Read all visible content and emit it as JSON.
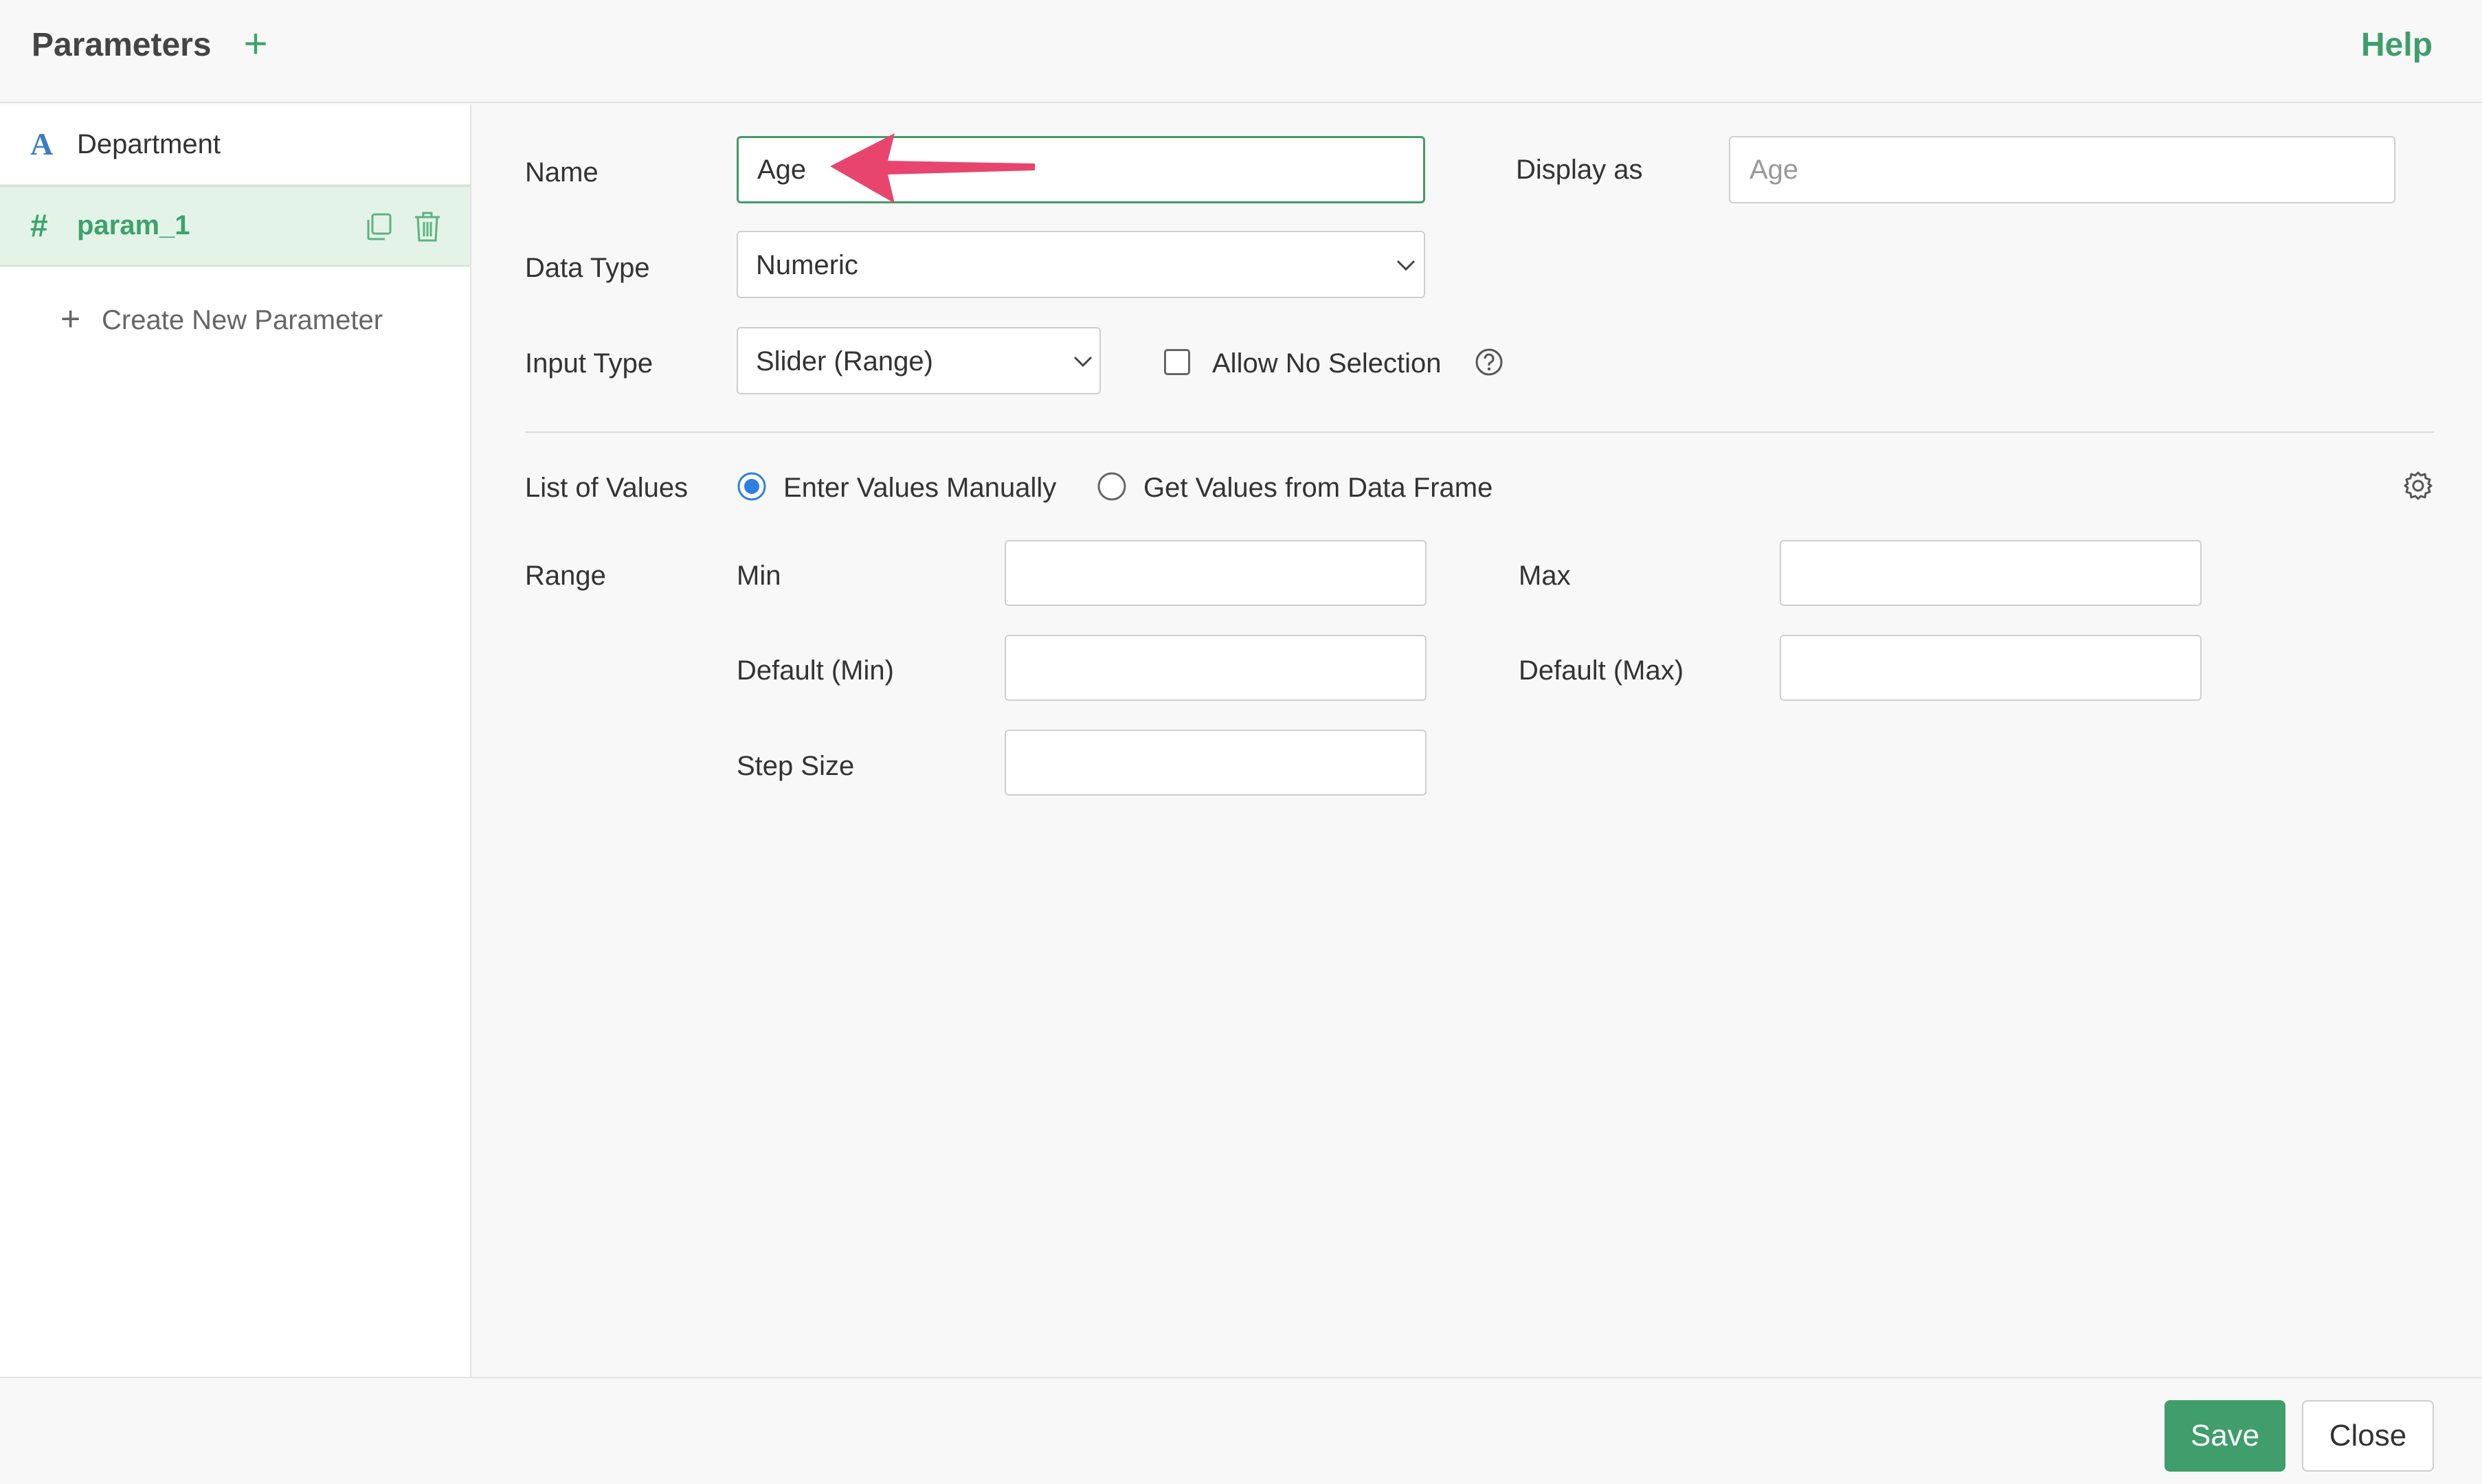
{
  "header": {
    "title": "Parameters",
    "add_icon": "plus-icon",
    "help_label": "Help"
  },
  "sidebar": {
    "items": [
      {
        "type_glyph": "A",
        "label": "Department",
        "selected": false
      },
      {
        "type_glyph": "#",
        "label": "param_1",
        "selected": true
      }
    ],
    "create_new_label": "Create New Parameter"
  },
  "form": {
    "name_label": "Name",
    "name_value": "Age",
    "display_as_label": "Display as",
    "display_as_placeholder": "Age",
    "data_type_label": "Data Type",
    "data_type_value": "Numeric",
    "input_type_label": "Input Type",
    "input_type_value": "Slider (Range)",
    "allow_no_selection_label": "Allow No Selection",
    "allow_no_selection_checked": false,
    "list_of_values_label": "List of Values",
    "radio_manual_label": "Enter Values Manually",
    "radio_manual_selected": true,
    "radio_dataframe_label": "Get Values from Data Frame",
    "radio_dataframe_selected": false,
    "range_label": "Range",
    "min_label": "Min",
    "max_label": "Max",
    "default_min_label": "Default (Min)",
    "default_max_label": "Default (Max)",
    "step_size_label": "Step Size"
  },
  "footer": {
    "save_label": "Save",
    "close_label": "Close"
  },
  "colors": {
    "accent_green": "#3f9e6b",
    "selected_bg": "#e4f3e8",
    "radio_blue": "#2f7fe0",
    "arrow_pink": "#e8456e"
  }
}
